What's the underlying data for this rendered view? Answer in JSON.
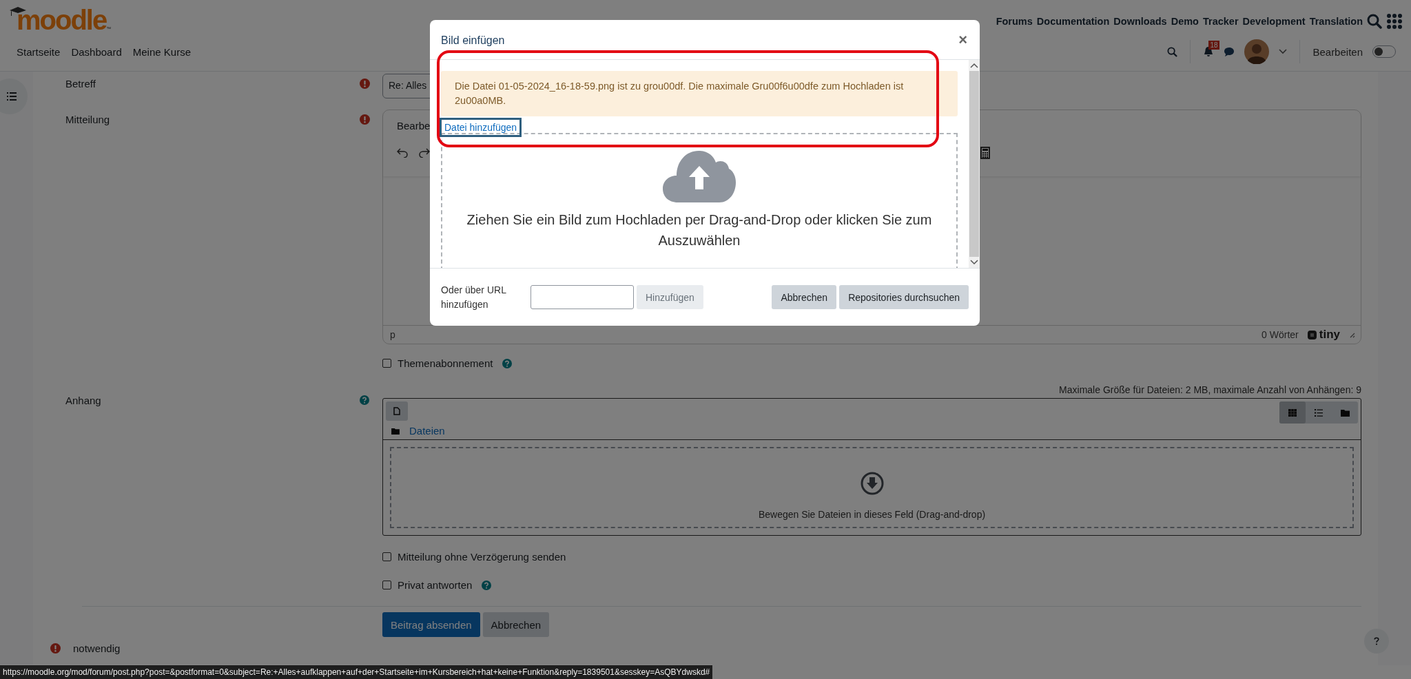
{
  "header": {
    "logo": "moodle",
    "trademark": "™",
    "top_links": [
      "Forums",
      "Documentation",
      "Downloads",
      "Demo",
      "Tracker",
      "Development",
      "Translation"
    ],
    "nav": [
      "Startseite",
      "Dashboard",
      "Meine Kurse"
    ],
    "notification_count": "18",
    "edit_mode": {
      "label": "Bearbeiten",
      "on": false
    }
  },
  "form": {
    "subject": {
      "label": "Betreff",
      "value": "Re: Alles"
    },
    "message": {
      "label": "Mitteilung",
      "menu": "Bearbe",
      "status_path": "p",
      "word_count": "0 Wörter",
      "brand": "tiny"
    },
    "subscribe": {
      "label": "Themenabonnement",
      "checked": false
    },
    "attachment": {
      "label": "Anhang",
      "limits": "Maximale Größe für Dateien: 2 MB, maximale Anzahl von Anhängen: 9",
      "folder": "Dateien",
      "drop_text": "Bewegen Sie Dateien in dieses Feld (Drag-and-drop)",
      "views": [
        {
          "kind": "grid",
          "selected": true
        },
        {
          "kind": "list",
          "selected": false
        },
        {
          "kind": "tree",
          "selected": false
        }
      ]
    },
    "options": [
      {
        "label": "Mitteilung ohne Verzögerung senden",
        "checked": false,
        "help": false
      },
      {
        "label": "Privat antworten",
        "checked": false,
        "help": true
      }
    ],
    "buttons": [
      {
        "label": "Beitrag absenden",
        "kind": "primary"
      },
      {
        "label": "Abbrechen",
        "kind": "secondary"
      }
    ],
    "required_note": "notwendig"
  },
  "dialog": {
    "title": "Bild einfügen",
    "close": "×",
    "highlighted": true,
    "error": "Die Datei 01-05-2024_16-18-59.png ist zu grou00df. Die maximale Gru00f6u00dfe zum Hochladen ist 2u00a0MB.",
    "add_file_link": "Datei hinzufügen",
    "drop_text": "Ziehen Sie ein Bild zum Hochladen per Drag-and-Drop oder klicken Sie zum Auszuwählen",
    "url_label": "Oder über URL hinzufügen",
    "add_button": {
      "label": "Hinzufügen",
      "disabled": true
    },
    "buttons": [
      "Abbrechen",
      "Repositories durchsuchen"
    ]
  },
  "status_url": "https://moodle.org/mod/forum/post.php?post=&postformat=0&subject=Re:+Alles+aufklappen+auf+der+Startseite+im+Kursbereich+hat+keine+Funktion&reply=1839501&sesskey=AsQBYdwskd#"
}
